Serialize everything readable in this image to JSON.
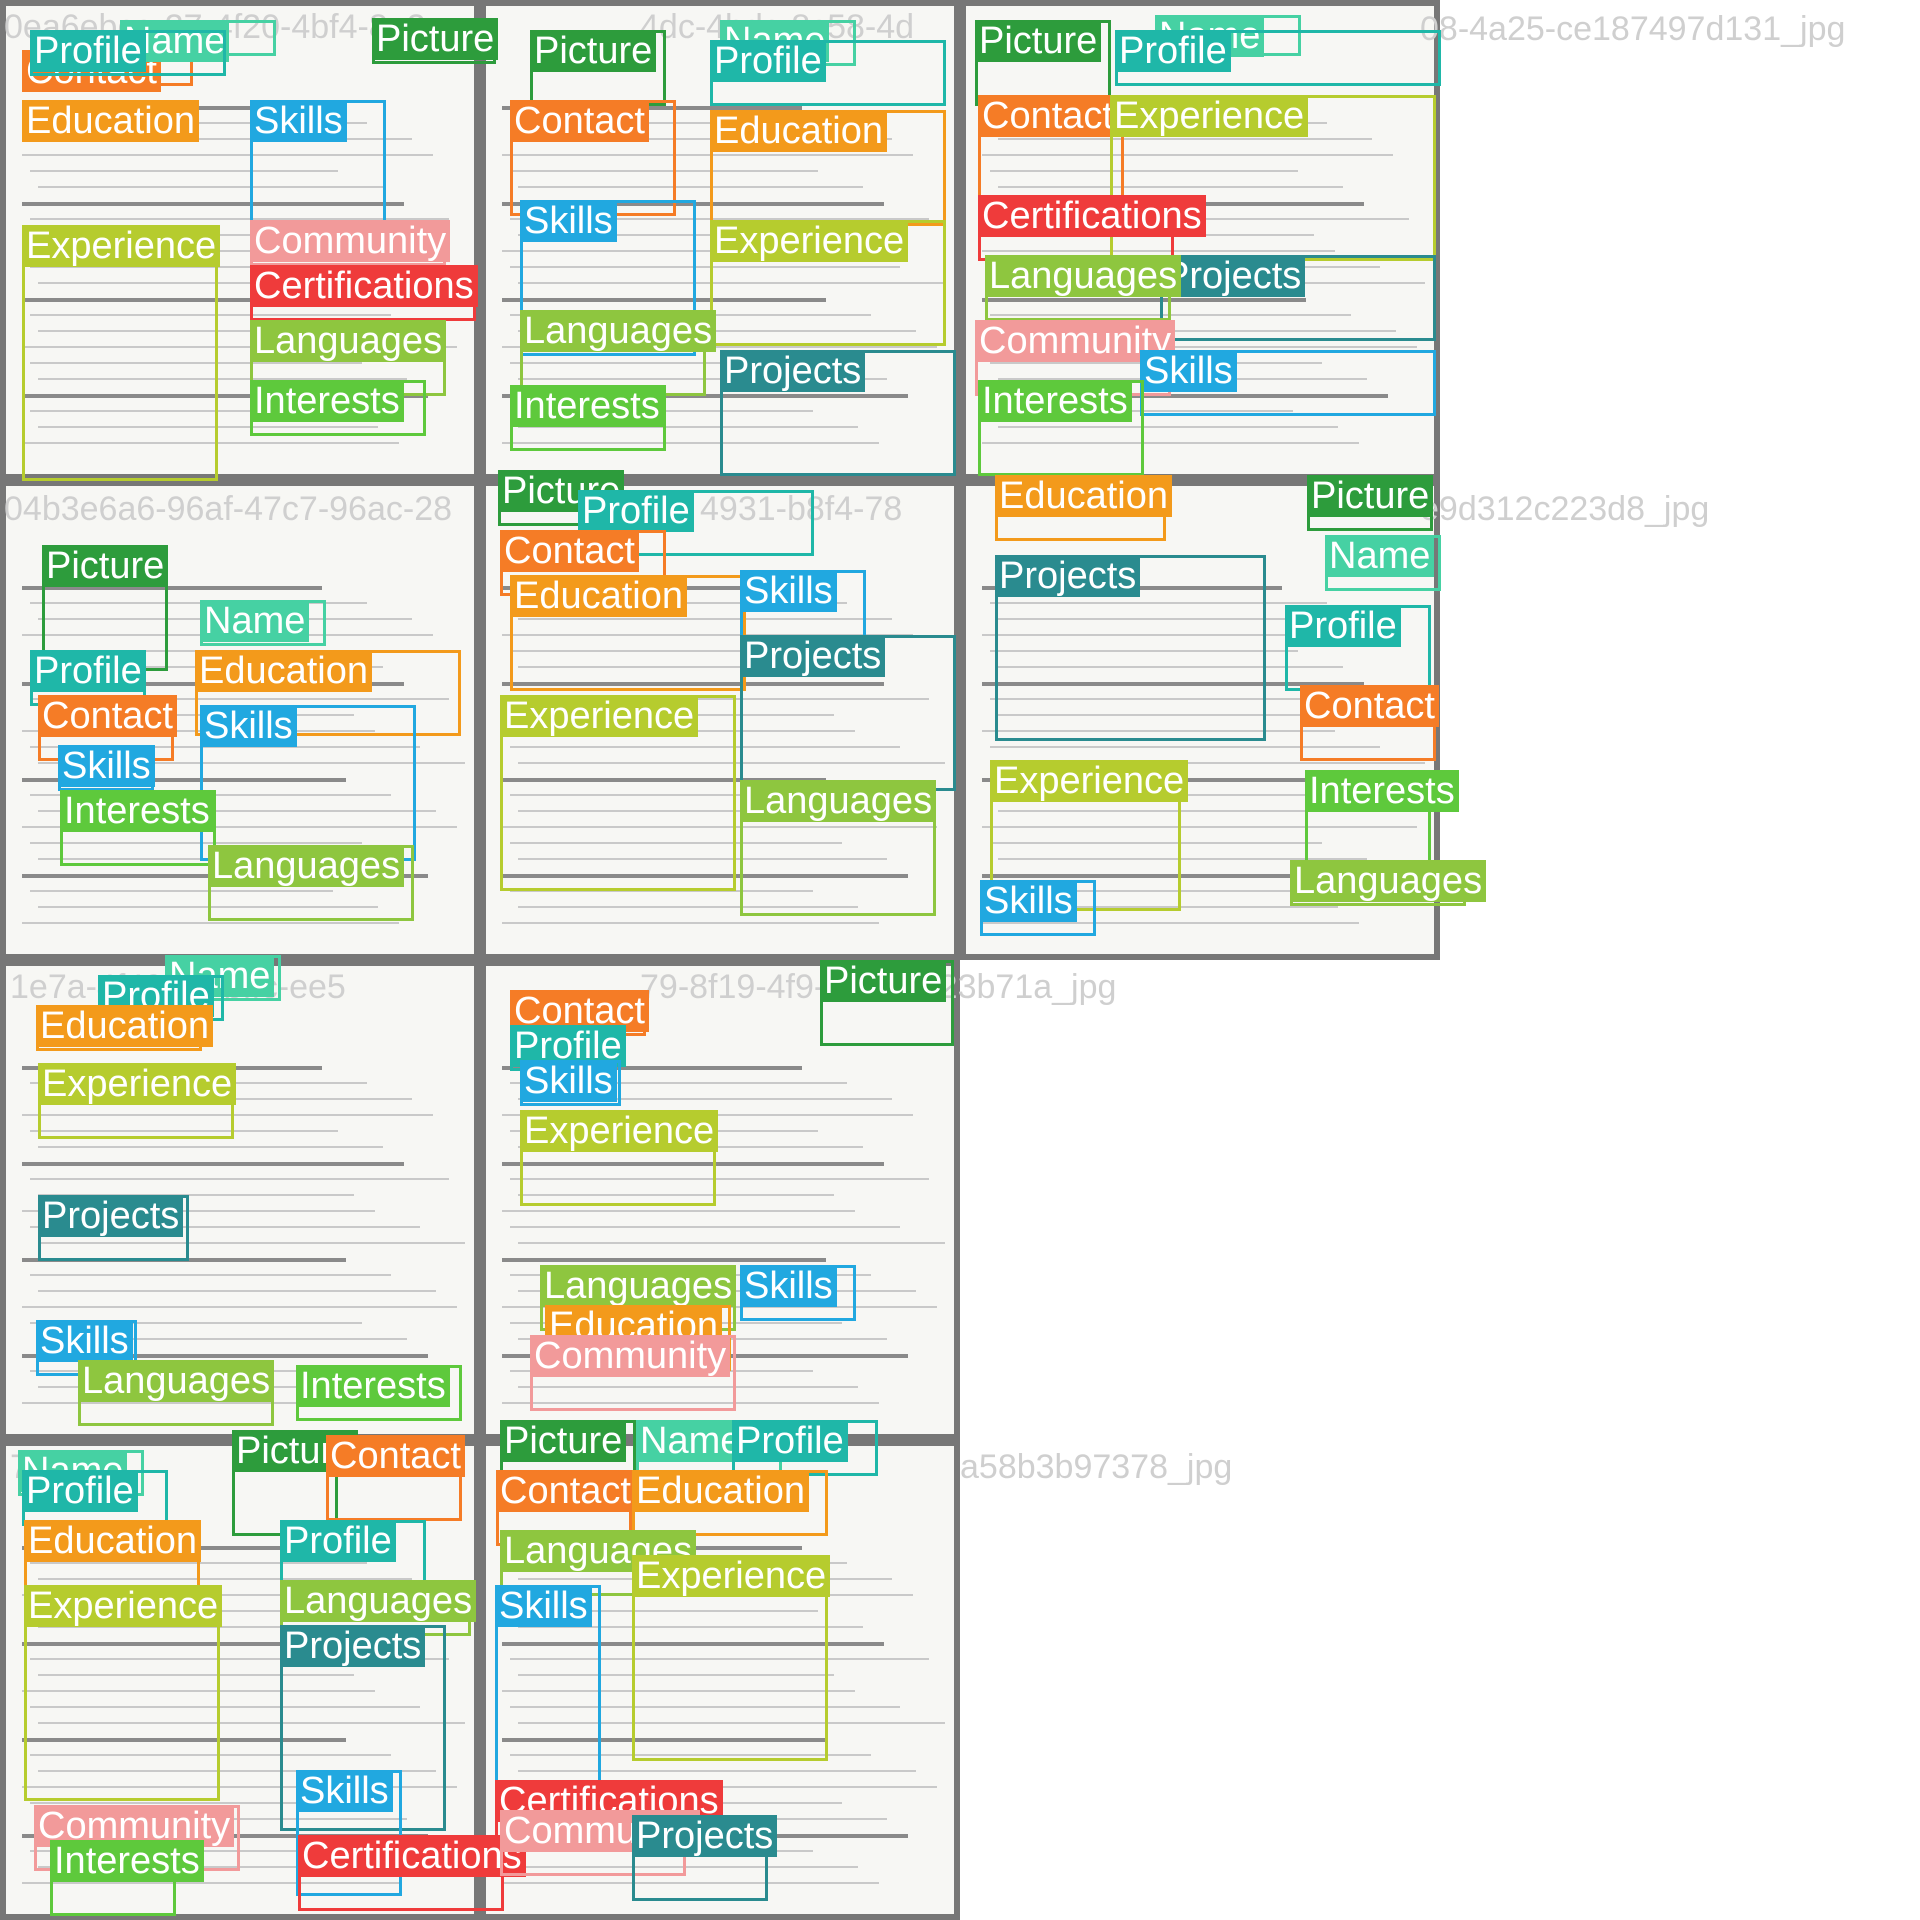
{
  "filenames": [
    "0ea6ebca-27-4f20-4bf4-8e2e",
    "4dc-4bdc-8c58-4d",
    "08-4a25-ce187497d131_jpg",
    "04b3e6a6-96af-47c7-96ac-28",
    "4931-b8f4-78",
    "e9d312c223d8_jpg",
    "1e7a-4f49-4b-bffc-ee5",
    "79-8f19-4f9-89560723b71a_jpg",
    "71-07",
    "a58b3b97378_jpg"
  ],
  "colors": {
    "Contact": "#f57c26",
    "Picture": "#2d9c3c",
    "Name": "#46d1a3",
    "Profile": "#1fb7a8",
    "Education": "#f39a1b",
    "Skills": "#21a8e0",
    "Experience": "#b6cc2e",
    "Community": "#f29a9a",
    "Certifications": "#ef3b3b",
    "Languages": "#8ec63f",
    "Interests": "#5ec93c",
    "Projects": "#2a8b8f"
  },
  "labels": [
    "Contact",
    "Picture",
    "Name",
    "Profile",
    "Education",
    "Skills",
    "Experience",
    "Community",
    "Certifications",
    "Languages",
    "Interests",
    "Projects"
  ]
}
